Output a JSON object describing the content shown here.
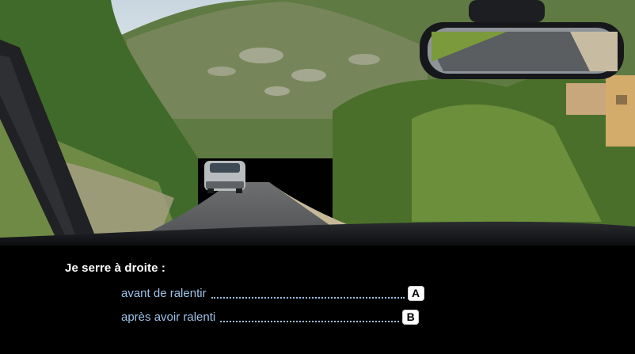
{
  "question": {
    "text": "Je serre à droite :"
  },
  "answers": [
    {
      "label": "avant de ralentir",
      "key": "A"
    },
    {
      "label": "après avoir ralenti",
      "key": "B"
    }
  ],
  "colors": {
    "panel_background": "#000000",
    "question_text": "#ffffff",
    "answer_text": "#9ec3ea",
    "key_background": "#ffffff"
  }
}
